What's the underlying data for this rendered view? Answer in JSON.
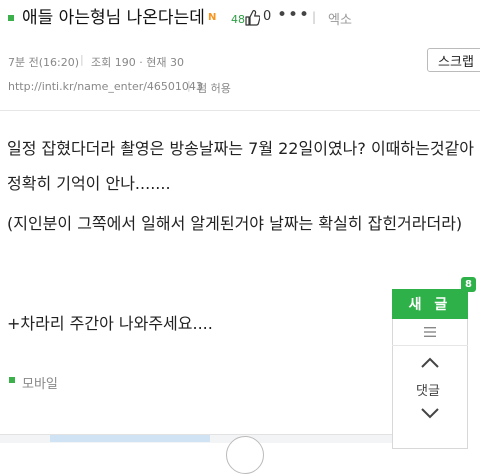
{
  "post": {
    "title": "애들 아는형님 나온다는데",
    "new_badge": "N",
    "likes": "48",
    "comment_count": "0",
    "more": "•••",
    "separator": "|",
    "author": "엑소",
    "time": "7분 전(16:20)",
    "views": "조회 190 · 현재 30",
    "url": "http://inti.kr/name_enter/46501043",
    "permission": "펌 허용",
    "scrap_label": "스크랩",
    "body_lines": [
      "일정 잡혔다더라 촬영은 방송날짜는 7월 22일이였나? 이때하는것같아",
      "정확히 기억이 안나.......",
      "(지인분이 그쪽에서 일해서 알게된거야 날짜는 확실히 잡힌거라더라)",
      "+차라리 주간아 나와주세요...."
    ],
    "device_label": "모바일"
  },
  "side_panel": {
    "write_label": "새 글",
    "new_count": "8",
    "comments_label": "댓글"
  },
  "icons": {
    "thumb": "thumbs-up-icon",
    "menu": "hamburger-menu-icon",
    "up": "chevron-up-icon",
    "down": "chevron-down-icon"
  },
  "colors": {
    "accent_green": "#2fb14a",
    "new_badge_orange": "#f7941d"
  }
}
